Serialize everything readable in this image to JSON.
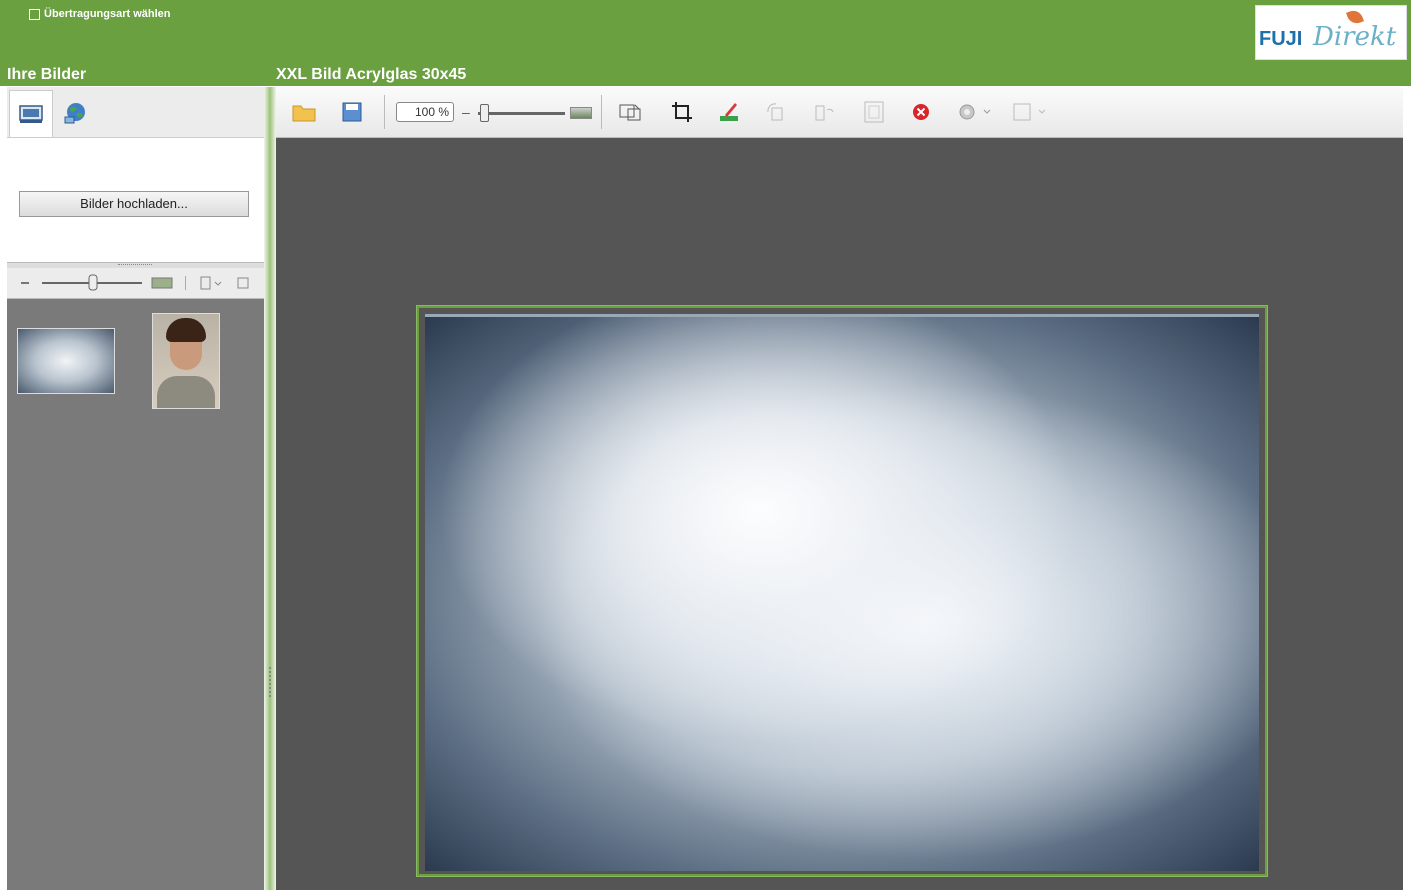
{
  "header": {
    "transfer_link": "Übertragungsart wählen",
    "logo_text_fuji": "FUJI",
    "logo_text_direkt": "Direkt"
  },
  "left_panel": {
    "title": "Ihre Bilder",
    "tabs": [
      {
        "icon": "image-icon",
        "active": true
      },
      {
        "icon": "globe-icon",
        "active": false
      }
    ],
    "upload_button": "Bilder hochladen...",
    "thumbnails": [
      {
        "kind": "cloud-photo"
      },
      {
        "kind": "portrait-photo"
      }
    ]
  },
  "editor": {
    "title": "XXL Bild Acrylglas 30x45",
    "zoom": "100 %",
    "zoom_minus": "–",
    "toolbar_icons": [
      "open-folder-icon",
      "save-icon",
      "fit-image-icon",
      "crop-icon",
      "edit-brush-icon",
      "rotate-icon",
      "flip-icon",
      "frame-icon",
      "delete-icon",
      "settings-icon",
      "layout-icon"
    ]
  },
  "colors": {
    "brand_green": "#6aa040",
    "canvas_gray": "#555555",
    "panel_gray": "#7a7a7a"
  }
}
